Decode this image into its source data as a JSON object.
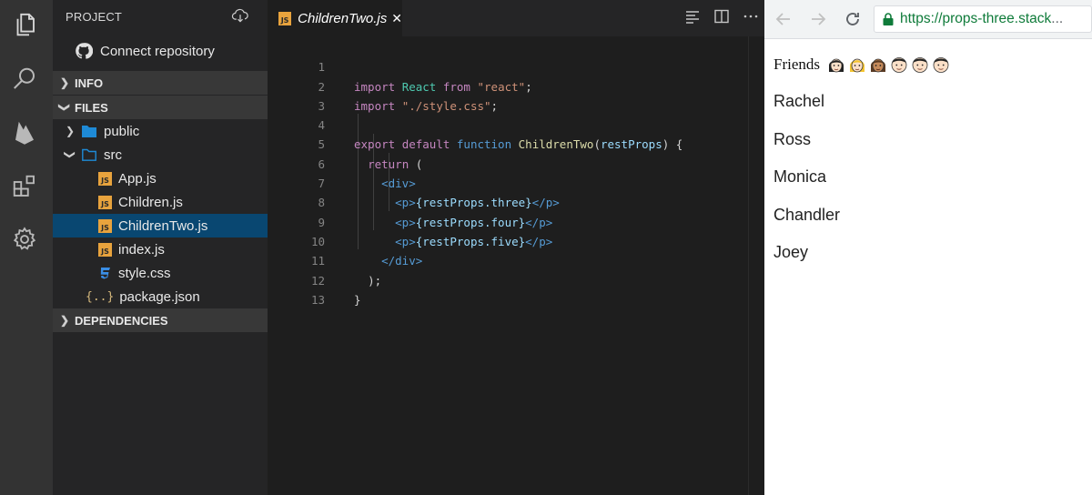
{
  "sidebar": {
    "header_title": "PROJECT",
    "connect_label": "Connect repository",
    "sections": {
      "info": "INFO",
      "files": "FILES",
      "dependencies": "DEPENDENCIES"
    },
    "tree": [
      {
        "label": "public",
        "type": "folder",
        "state": "collapsed"
      },
      {
        "label": "src",
        "type": "folder",
        "state": "expanded"
      },
      {
        "label": "App.js",
        "type": "js"
      },
      {
        "label": "Children.js",
        "type": "js"
      },
      {
        "label": "ChildrenTwo.js",
        "type": "js",
        "selected": true
      },
      {
        "label": "index.js",
        "type": "js"
      },
      {
        "label": "style.css",
        "type": "css"
      },
      {
        "label": "package.json",
        "type": "json"
      }
    ],
    "badge_js": "JS",
    "json_icon": "{..}"
  },
  "editor": {
    "tab_label": "ChildrenTwo.js",
    "tab_close": "✕",
    "line_numbers": [
      "1",
      "2",
      "3",
      "4",
      "5",
      "6",
      "7",
      "8",
      "9",
      "10",
      "11",
      "12",
      "13"
    ],
    "code": {
      "l1": {
        "kw": "import",
        "name": "React",
        "from": "from",
        "str": "\"react\"",
        "end": ";"
      },
      "l2": {
        "kw": "import",
        "str": "\"./style.css\"",
        "end": ";"
      },
      "l4": {
        "export": "export",
        "default": "default",
        "function": "function",
        "fn": "ChildrenTwo",
        "open": "(",
        "param": "restProps",
        "close": ") {"
      },
      "l5": {
        "ret": "return",
        "paren": "("
      },
      "l6": {
        "tag": "<div>"
      },
      "l7": {
        "open": "<p>",
        "expr": "{restProps.three}",
        "close": "</p>"
      },
      "l8": {
        "open": "<p>",
        "expr": "{restProps.four}",
        "close": "</p>"
      },
      "l9": {
        "open": "<p>",
        "expr": "{restProps.five}",
        "close": "</p>"
      },
      "l10": {
        "tag": "</div>"
      },
      "l11": {
        "text": ");"
      },
      "l12": {
        "text": "}"
      }
    }
  },
  "browser": {
    "url_host": "https://props-three.stack",
    "url_rest": "...",
    "friends_label": "Friends",
    "names": [
      "Rachel",
      "Ross",
      "Monica",
      "Chandler",
      "Joey"
    ]
  },
  "colors": {
    "selection": "#094771",
    "activity_bar": "#333333",
    "sidebar": "#252526",
    "editor_bg": "#1e1e1e",
    "badge_js": "#e8a33d",
    "lock_green": "#0f7b3a"
  }
}
